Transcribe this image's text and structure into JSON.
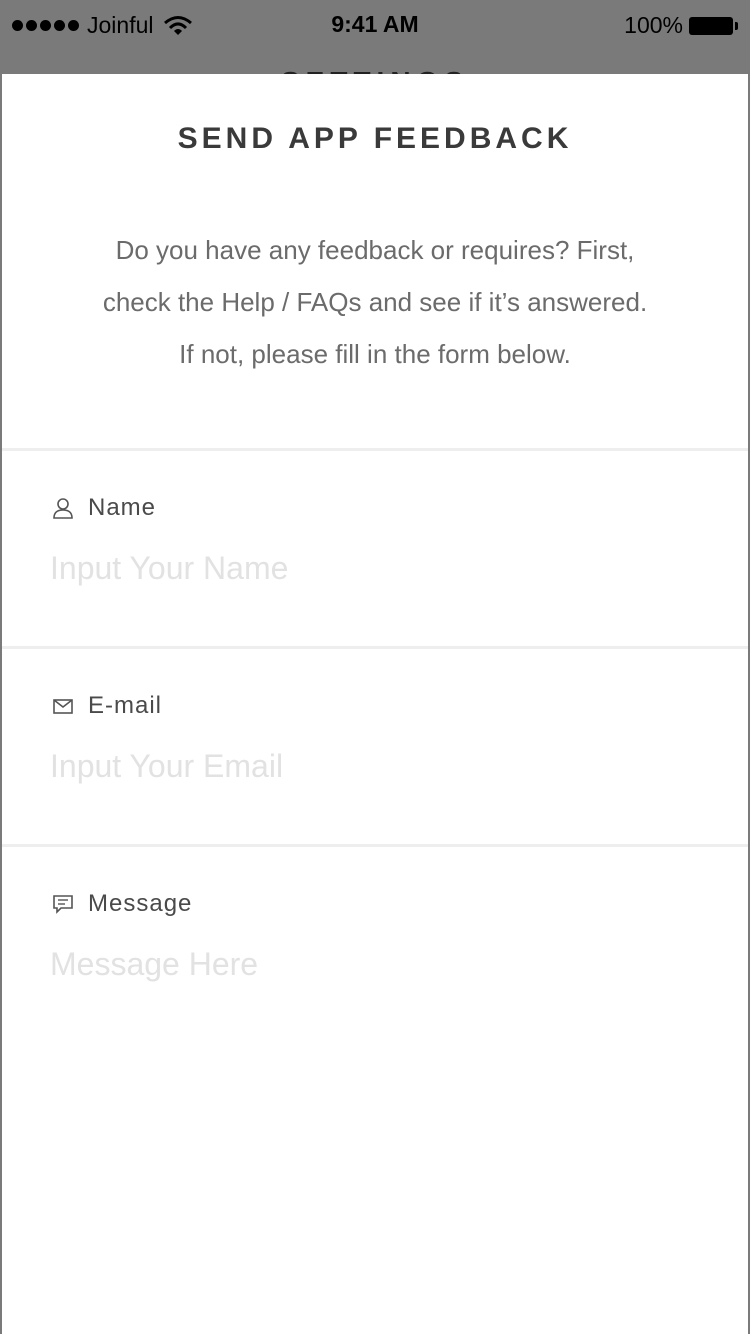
{
  "status_bar": {
    "carrier": "Joinful",
    "time": "9:41 AM",
    "battery": "100%"
  },
  "background_title": "SETTINGS",
  "sheet": {
    "title": "SEND APP FEEDBACK",
    "intro_lines": [
      "Do you have any feedback or requires? First,",
      "check the Help / FAQs and see if it’s answered.",
      "If not, please fill in the form below."
    ]
  },
  "form": {
    "name": {
      "label": "Name",
      "icon": "person-icon",
      "placeholder": "Input Your Name",
      "value": ""
    },
    "email": {
      "label": "E-mail",
      "icon": "envelope-icon",
      "placeholder": "Input Your Email",
      "value": ""
    },
    "message": {
      "label": "Message",
      "icon": "chat-bubble-icon",
      "placeholder": "Message Here",
      "value": ""
    }
  },
  "colors": {
    "overlay": "#7a7a7a",
    "sheet_background": "#ffffff",
    "title_text": "#3a3a3a",
    "body_text": "#6b6b6b",
    "placeholder_text": "#e2e2e2",
    "divider": "#eeeeee"
  }
}
